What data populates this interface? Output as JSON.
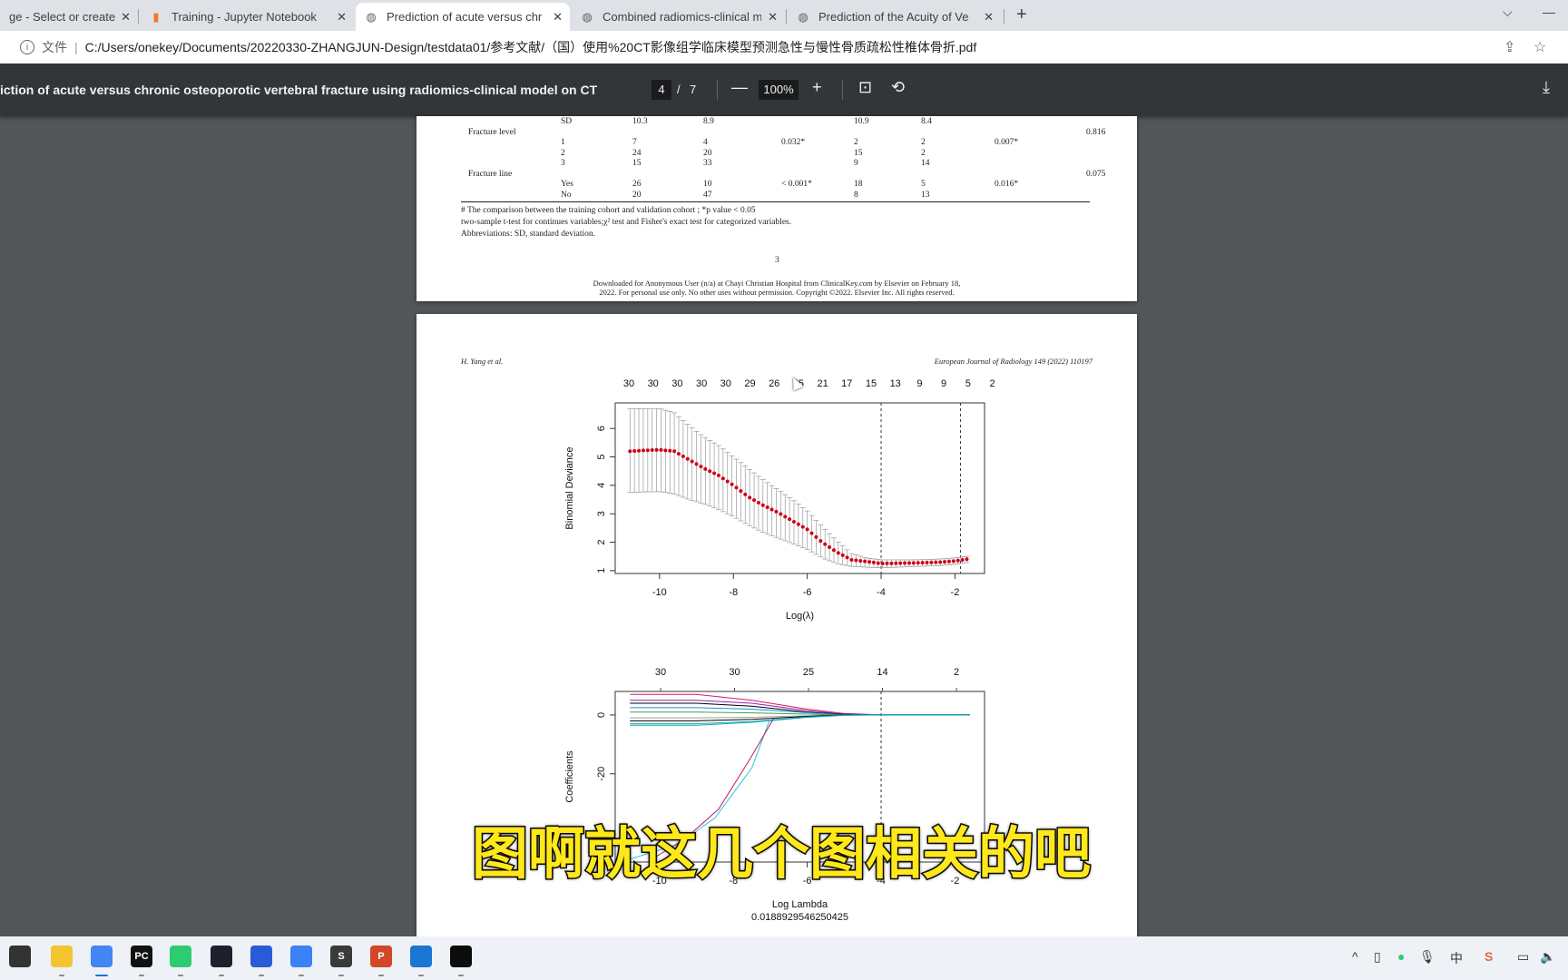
{
  "browser": {
    "tabs": [
      {
        "title": "ge - Select or create",
        "icon": "page-icon",
        "active": false
      },
      {
        "title": "Training - Jupyter Notebook",
        "icon": "jupyter-icon",
        "active": false
      },
      {
        "title": "Prediction of acute versus chr",
        "icon": "globe-icon",
        "active": true
      },
      {
        "title": "Combined radiomics-clinical m",
        "icon": "globe-icon",
        "active": false
      },
      {
        "title": "Prediction of the Acuity of Ve",
        "icon": "globe-icon",
        "active": false
      }
    ],
    "close_glyph": "✕",
    "new_tab_glyph": "+",
    "tab_search_glyph": "⌵",
    "minimize_glyph": "—",
    "address": {
      "info_glyph": "i",
      "scheme_label": "文件",
      "url": "C:/Users/onekey/Documents/20220330-ZHANGJUN-Design/testdata01/参考文献/（国）使用%20CT影像组学临床模型预测急性与慢性骨质疏松性椎体骨折.pdf",
      "share_glyph": "⇪",
      "star_glyph": "☆"
    }
  },
  "pdf_toolbar": {
    "doc_title": "iction of acute versus chronic osteoporotic vertebral fracture using radiomics-clinical model on CT",
    "current_page": "4",
    "page_sep": "/",
    "total_pages": "7",
    "zoom_out_glyph": "—",
    "zoom_level": "100%",
    "zoom_in_glyph": "+",
    "fit_glyph": "⊡",
    "rotate_glyph": "⟲",
    "download_glyph": "⤓"
  },
  "page3": {
    "table_rows": [
      {
        "label": "",
        "sub": "SD",
        "c1": "10.3",
        "c2": "8.9",
        "p1": "",
        "c3": "10.9",
        "c4": "8.4",
        "p2": "",
        "p3": ""
      },
      {
        "label": "Fracture level",
        "sub": "",
        "c1": "",
        "c2": "",
        "p1": "",
        "c3": "",
        "c4": "",
        "p2": "",
        "p3": "0.816"
      },
      {
        "label": "",
        "sub": "1",
        "c1": "7",
        "c2": "4",
        "p1": "0.032*",
        "c3": "2",
        "c4": "2",
        "p2": "0.007*",
        "p3": ""
      },
      {
        "label": "",
        "sub": "2",
        "c1": "24",
        "c2": "20",
        "p1": "",
        "c3": "15",
        "c4": "2",
        "p2": "",
        "p3": ""
      },
      {
        "label": "",
        "sub": "3",
        "c1": "15",
        "c2": "33",
        "p1": "",
        "c3": "9",
        "c4": "14",
        "p2": "",
        "p3": ""
      },
      {
        "label": "Fracture line",
        "sub": "",
        "c1": "",
        "c2": "",
        "p1": "",
        "c3": "",
        "c4": "",
        "p2": "",
        "p3": "0.075"
      },
      {
        "label": "",
        "sub": "Yes",
        "c1": "26",
        "c2": "10",
        "p1": "< 0.001*",
        "c3": "18",
        "c4": "5",
        "p2": "0.016*",
        "p3": ""
      },
      {
        "label": "",
        "sub": "No",
        "c1": "20",
        "c2": "47",
        "p1": "",
        "c3": "8",
        "c4": "13",
        "p2": "",
        "p3": ""
      }
    ],
    "footnotes": [
      "# The comparison between the training cohort and validation cohort ; *p value < 0.05",
      "two-sample t-test for continues variables;χ² test and Fisher's exact test for categorized variables.",
      "Abbreviations: SD, standard deviation."
    ],
    "page_number": "3",
    "download_notice": [
      "Downloaded for Anonymous User (n/a) at Chayi Christian Hospital from ClinicalKey.com by Elsevier on February 18,",
      "2022. For personal use only. No other uses without permission. Copyright ©2022. Elsevier Inc. All rights reserved."
    ]
  },
  "page4": {
    "header_left": "H. Yang et al.",
    "header_right": "European Journal of Radiology 149 (2022) 110197"
  },
  "chart_data": [
    {
      "type": "scatter",
      "title": "",
      "xlabel": "Log(λ)",
      "ylabel": "Binomial Deviance",
      "xlim": [
        -11.2,
        -1.2
      ],
      "ylim": [
        0.9,
        6.9
      ],
      "x_ticks": [
        -10,
        -8,
        -6,
        -4,
        -2
      ],
      "y_ticks": [
        1,
        2,
        3,
        4,
        5,
        6
      ],
      "top_axis_labels": [
        "30",
        "30",
        "30",
        "30",
        "30",
        "29",
        "26",
        "25",
        "21",
        "17",
        "15",
        "13",
        "9",
        "9",
        "5",
        "2"
      ],
      "vlines": [
        -4.0,
        -1.85
      ],
      "series": [
        {
          "name": "cv-mean",
          "color": "#d0021b",
          "x": [
            -10.8,
            -10.4,
            -10.0,
            -9.6,
            -9.2,
            -8.8,
            -8.4,
            -8.0,
            -7.6,
            -7.2,
            -6.8,
            -6.4,
            -6.0,
            -5.6,
            -5.2,
            -4.8,
            -4.4,
            -4.0,
            -3.6,
            -3.2,
            -2.8,
            -2.4,
            -2.0,
            -1.6
          ],
          "y": [
            5.2,
            5.23,
            5.25,
            5.2,
            4.9,
            4.6,
            4.35,
            4.0,
            3.6,
            3.3,
            3.05,
            2.75,
            2.45,
            2.0,
            1.65,
            1.38,
            1.32,
            1.25,
            1.26,
            1.27,
            1.28,
            1.3,
            1.34,
            1.42
          ],
          "upper": [
            6.7,
            6.7,
            6.7,
            6.55,
            6.1,
            5.7,
            5.4,
            5.0,
            4.6,
            4.2,
            3.85,
            3.5,
            3.1,
            2.55,
            2.05,
            1.6,
            1.45,
            1.38,
            1.38,
            1.38,
            1.39,
            1.41,
            1.45,
            1.52
          ],
          "lower": [
            3.75,
            3.77,
            3.78,
            3.7,
            3.5,
            3.35,
            3.15,
            2.9,
            2.6,
            2.35,
            2.15,
            1.95,
            1.75,
            1.45,
            1.25,
            1.15,
            1.12,
            1.1,
            1.12,
            1.14,
            1.16,
            1.18,
            1.22,
            1.3
          ]
        }
      ]
    },
    {
      "type": "line",
      "title": "",
      "xlabel": "Log Lambda",
      "caption": "0.0188929546250425",
      "ylabel": "Coefficients",
      "xlim": [
        -11.2,
        -1.2
      ],
      "ylim": [
        -50,
        8
      ],
      "x_ticks": [
        -10,
        -8,
        -6,
        -4,
        -2
      ],
      "y_ticks": [
        0,
        -20,
        -40
      ],
      "top_axis_labels": [
        "30",
        "30",
        "25",
        "14",
        "2"
      ],
      "vlines": [
        -4.0
      ],
      "series": [
        {
          "name": "coef-1",
          "color": "#d81b60",
          "x": [
            -10.8,
            -9,
            -7.5,
            -6,
            -5,
            -4,
            -1.6
          ],
          "y": [
            7,
            7,
            5,
            2,
            0.5,
            0,
            0
          ]
        },
        {
          "name": "coef-2",
          "color": "#8e24aa",
          "x": [
            -10.8,
            -9,
            -7.5,
            -6,
            -5,
            -4,
            -1.6
          ],
          "y": [
            5,
            5,
            4,
            1.5,
            0.3,
            0,
            0
          ]
        },
        {
          "name": "coef-3",
          "color": "#000000",
          "x": [
            -10.8,
            -9,
            -7.5,
            -6,
            -5,
            -4,
            -1.6
          ],
          "y": [
            4,
            4,
            3,
            1,
            0.2,
            0,
            0
          ]
        },
        {
          "name": "coef-4",
          "color": "#1e88e5",
          "x": [
            -10.8,
            -9,
            -7.5,
            -6,
            -5,
            -4,
            -1.6
          ],
          "y": [
            2.5,
            2.5,
            2,
            0.8,
            0.1,
            0,
            0
          ]
        },
        {
          "name": "coef-5",
          "color": "#43a047",
          "x": [
            -10.8,
            -9,
            -7.5,
            -6,
            -5,
            -4,
            -1.6
          ],
          "y": [
            1,
            1,
            0.7,
            0.3,
            0,
            0,
            0
          ]
        },
        {
          "name": "coef-6",
          "color": "#9e9e9e",
          "x": [
            -10.8,
            -9,
            -7.5,
            -6,
            -5,
            -4,
            -1.6
          ],
          "y": [
            -1,
            -1,
            -0.8,
            -0.3,
            0,
            0,
            0
          ]
        },
        {
          "name": "coef-7",
          "color": "#000000",
          "x": [
            -10.8,
            -9,
            -7.5,
            -6,
            -5,
            -4,
            -1.6
          ],
          "y": [
            -2,
            -2,
            -1.5,
            -0.5,
            0,
            0,
            0
          ]
        },
        {
          "name": "coef-8",
          "color": "#26a69a",
          "x": [
            -10.8,
            -9,
            -7.5,
            -6,
            -5,
            -4,
            -1.6
          ],
          "y": [
            -3,
            -3,
            -2.2,
            -0.7,
            -0.1,
            0,
            0
          ]
        },
        {
          "name": "coef-9",
          "color": "#00acc1",
          "x": [
            -10.8,
            -9,
            -7.5,
            -6,
            -5,
            -4,
            -1.6
          ],
          "y": [
            -3.5,
            -3.5,
            -2.5,
            -0.8,
            -0.1,
            0,
            0
          ]
        },
        {
          "name": "coef-10",
          "color": "#26c6da",
          "x": [
            -10.8,
            -9.5,
            -8.5,
            -7.5,
            -7.0
          ],
          "y": [
            -49,
            -44,
            -35,
            -18,
            -1
          ]
        },
        {
          "name": "coef-11",
          "color": "#c2185b",
          "x": [
            -10.2,
            -9.3,
            -8.4,
            -7.6,
            -6.9
          ],
          "y": [
            -49,
            -42,
            -32,
            -16,
            -1
          ]
        }
      ]
    }
  ],
  "subtitle": "图啊就这几个图相关的吧",
  "taskbar": {
    "apps": [
      {
        "name": "task-view-icon",
        "label": "",
        "bg": "#333333"
      },
      {
        "name": "file-explorer-icon",
        "label": "",
        "bg": "#f4c430"
      },
      {
        "name": "chrome-icon",
        "label": "",
        "bg": "#4285f4"
      },
      {
        "name": "pycharm-icon",
        "label": "PC",
        "bg": "#111111"
      },
      {
        "name": "wechat-icon",
        "label": "",
        "bg": "#2ecc71"
      },
      {
        "name": "camera-app-icon",
        "label": "",
        "bg": "#1f1f2e"
      },
      {
        "name": "remote-desktop-icon",
        "label": "",
        "bg": "#2a5bd7"
      },
      {
        "name": "feishu-icon",
        "label": "",
        "bg": "#3b82f6"
      },
      {
        "name": "sublime-icon",
        "label": "S",
        "bg": "#3a3a3a"
      },
      {
        "name": "powerpoint-icon",
        "label": "P",
        "bg": "#d24726"
      },
      {
        "name": "meeting-app-icon",
        "label": "",
        "bg": "#1976d2"
      },
      {
        "name": "terminal-icon",
        "label": "",
        "bg": "#0c0c0c"
      }
    ],
    "tray": {
      "chevron_glyph": "^",
      "usb_glyph": "▯",
      "mic_glyph": "🎙",
      "ime_label": "中",
      "sogou_label": "S",
      "network_glyph": "▭",
      "volume_glyph": "🔈"
    }
  }
}
